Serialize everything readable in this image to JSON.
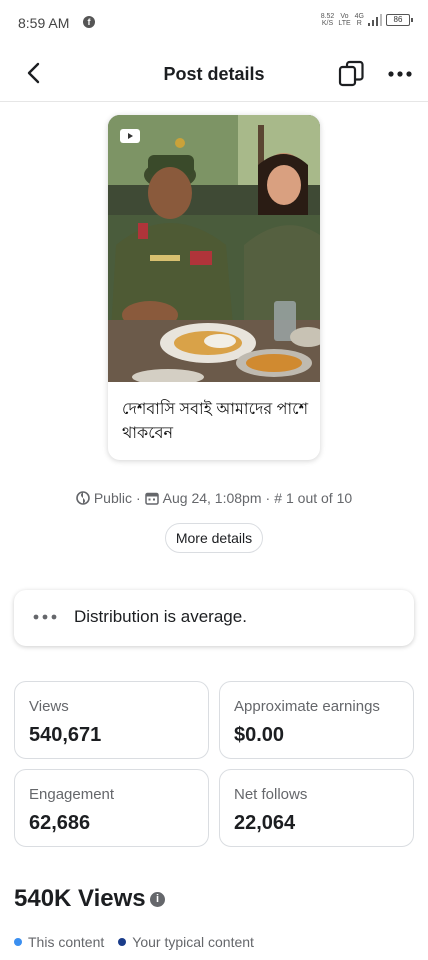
{
  "status_bar": {
    "time": "8:59 AM",
    "app_badge": "f",
    "net_speed_value": "8.52",
    "net_speed_unit": "K/S",
    "volte_top": "Vo",
    "volte_bottom": "LTE",
    "network_top": "4G",
    "network_bottom": "R",
    "battery": "86"
  },
  "header": {
    "title": "Post details",
    "icons": {
      "back": "arrow-left-icon",
      "copy": "copy-icon",
      "more": "more-horizontal-icon"
    }
  },
  "post": {
    "caption": "দেশবাসি সবাই আমাদের পাশে থাকবেন",
    "media_type": "video-icon"
  },
  "meta": {
    "audience": "Public",
    "date": "Aug 24, 1:08pm",
    "rank_symbol": "#",
    "rank": "1 out of 10",
    "separator": "·"
  },
  "more_details_label": "More details",
  "distribution": {
    "text": "Distribution is average."
  },
  "stats": [
    {
      "label": "Views",
      "value": "540,671"
    },
    {
      "label": "Approximate earnings",
      "value": "$0.00"
    },
    {
      "label": "Engagement",
      "value": "62,686"
    },
    {
      "label": "Net follows",
      "value": "22,064"
    }
  ],
  "views_section": {
    "heading": "540K Views",
    "info_glyph": "i",
    "legend": [
      {
        "label": "This content",
        "color": "#3b8ff0"
      },
      {
        "label": "Your typical content",
        "color": "#1a3c8a"
      }
    ]
  }
}
